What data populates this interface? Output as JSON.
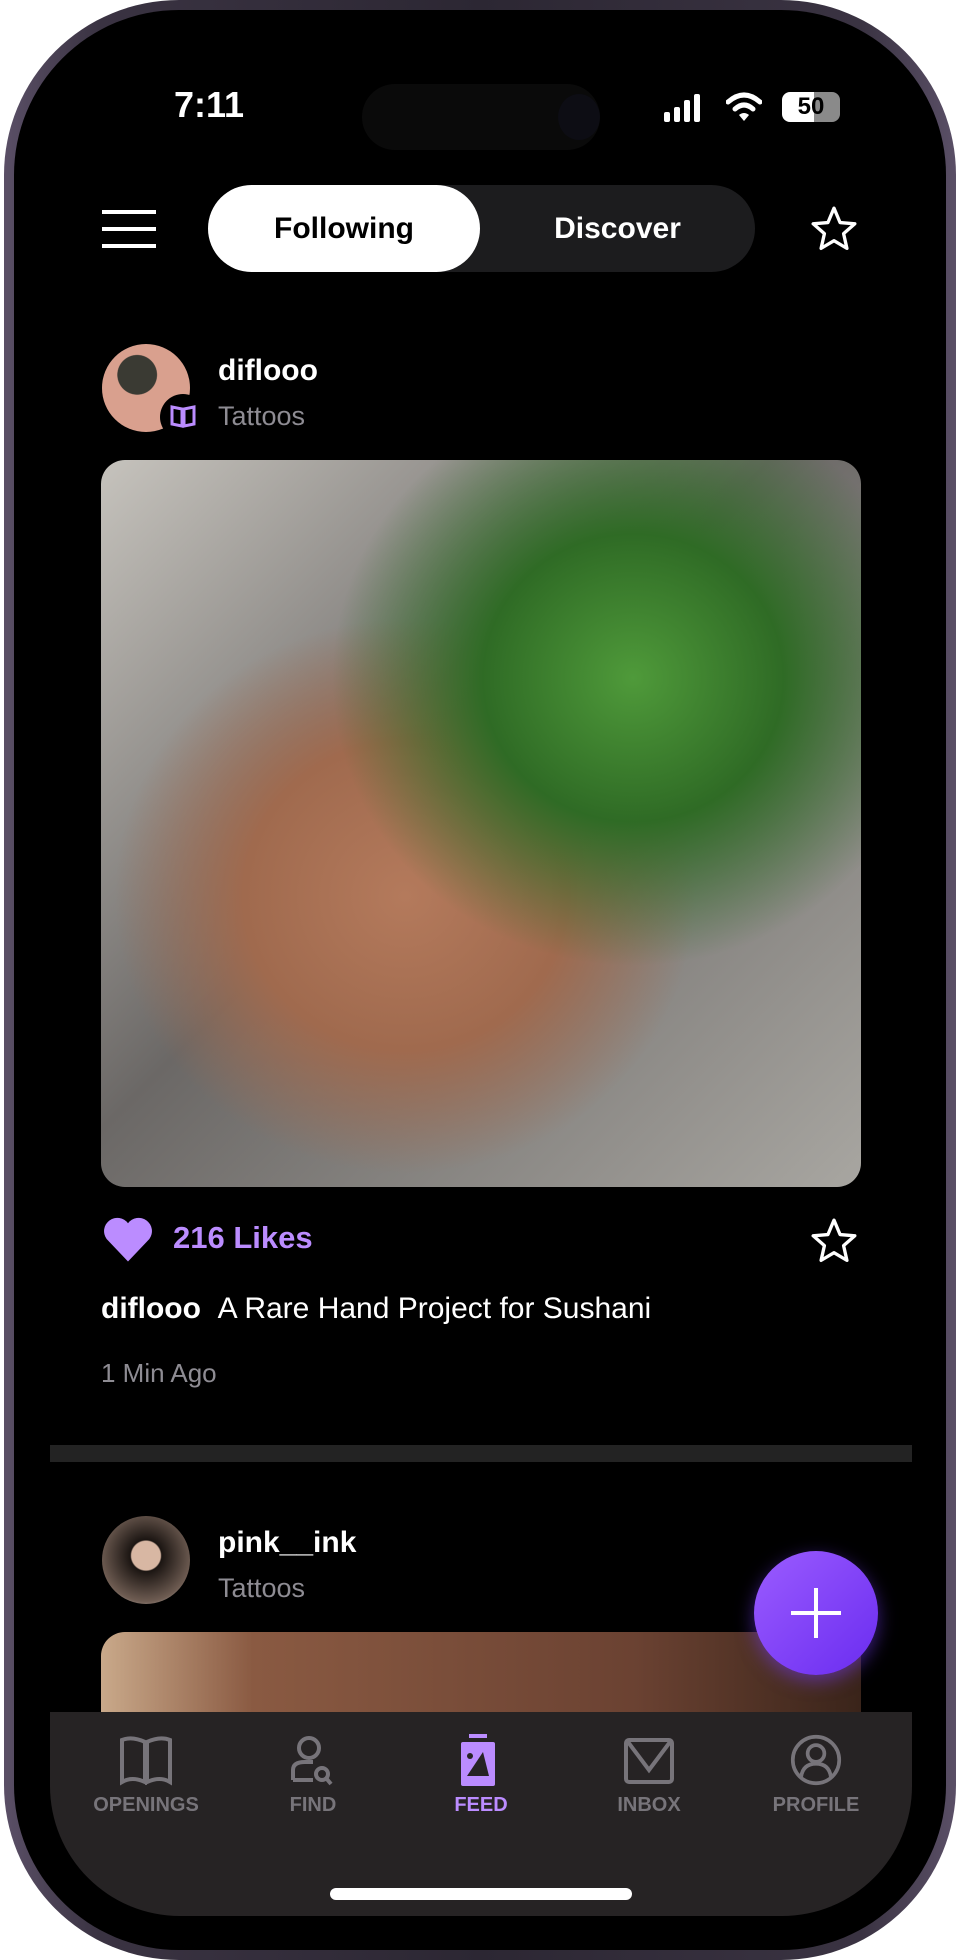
{
  "status_bar": {
    "time": "7:11",
    "battery": "50"
  },
  "header": {
    "tabs": [
      {
        "label": "Following",
        "active": true
      },
      {
        "label": "Discover",
        "active": false
      }
    ],
    "menu_icon": "hamburger-icon",
    "favorites_icon": "star-icon"
  },
  "posts": [
    {
      "username": "diflooo",
      "category": "Tattoos",
      "category_icon": "book-icon",
      "likes": "216 Likes",
      "caption_user": "diflooo",
      "caption": "A Rare Hand Project for Sushani",
      "time": "1 Min Ago"
    },
    {
      "username": "pink__ink",
      "category": "Tattoos"
    }
  ],
  "fab": {
    "icon": "plus-icon"
  },
  "nav": {
    "items": [
      {
        "label": "OPENINGS",
        "icon": "book-icon"
      },
      {
        "label": "FIND",
        "icon": "user-search-icon"
      },
      {
        "label": "FEED",
        "icon": "image-feed-icon",
        "active": true
      },
      {
        "label": "INBOX",
        "icon": "mail-icon"
      },
      {
        "label": "PROFILE",
        "icon": "profile-icon"
      }
    ]
  },
  "colors": {
    "accent": "#bb8cff",
    "fab": "#7b3cff",
    "nav_bg": "#262324"
  }
}
